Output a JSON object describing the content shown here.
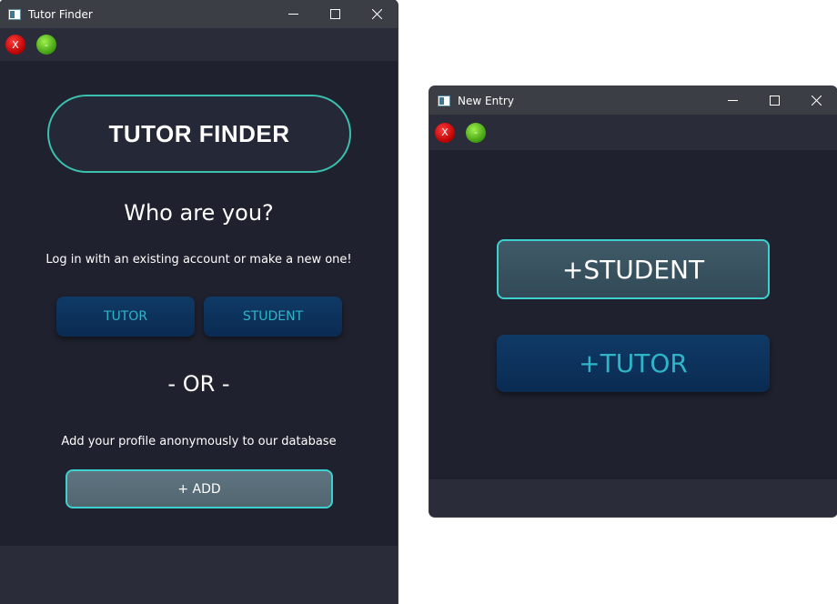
{
  "main_window": {
    "title": "Tutor Finder",
    "toolbar": {
      "close_label": "X",
      "minimize_label": "-"
    },
    "logo_text": "TUTOR FINDER",
    "who_heading": "Who are you?",
    "login_text": "Log in with an existing account or make a new one!",
    "tutor_button": "TUTOR",
    "student_button": "STUDENT",
    "or_text": "- OR -",
    "anon_text": "Add your profile anonymously to our database",
    "add_button": "+ ADD"
  },
  "entry_window": {
    "title": "New Entry",
    "toolbar": {
      "close_label": "X",
      "minimize_label": "-"
    },
    "student_button": "+STUDENT",
    "tutor_button": "+TUTOR"
  },
  "icons": {
    "window_minimize": "minimize-icon",
    "window_maximize": "maximize-icon",
    "window_close": "close-icon",
    "app": "app-icon"
  },
  "colors": {
    "background": "#1f212e",
    "panel": "#2a2c3a",
    "accent_teal": "#3bbfae",
    "button_blue": "#0f3a66",
    "button_text_teal": "#2fb4c8"
  }
}
